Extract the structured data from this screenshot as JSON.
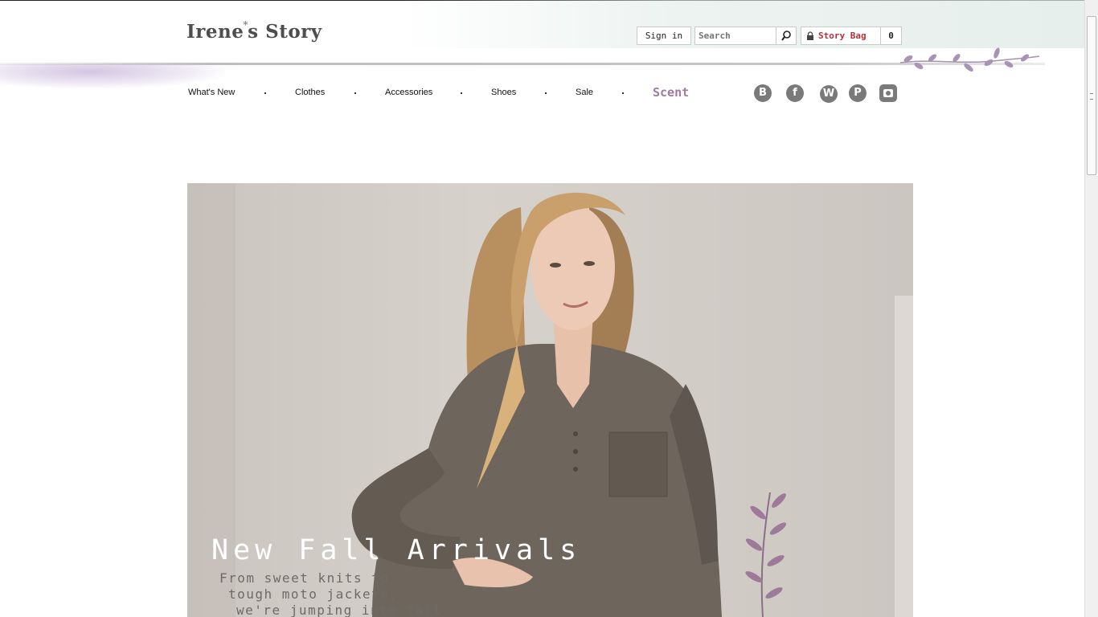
{
  "header": {
    "logo_left": "Irene",
    "logo_star": "*",
    "logo_right": "s Story",
    "sign_in": "Sign in",
    "search_placeholder": "Search",
    "bag_label": "Story Bag",
    "bag_count": "0"
  },
  "nav": {
    "items": [
      "What's New",
      "Clothes",
      "Accessories",
      "Shoes",
      "Sale",
      "Scent"
    ]
  },
  "social": {
    "blogger": "blogger-icon",
    "facebook": "facebook-icon",
    "wordpress": "wordpress-icon",
    "pinterest": "pinterest-icon",
    "instagram": "instagram-icon"
  },
  "hero": {
    "title": "New Fall Arrivals",
    "lines": [
      "From sweet knits to",
      "tough moto jackets,",
      "we're jumping into fall"
    ]
  },
  "colors": {
    "bag_text": "#b2323a",
    "scent": "#a07aa0",
    "social_icon": "#7a7a7a"
  }
}
